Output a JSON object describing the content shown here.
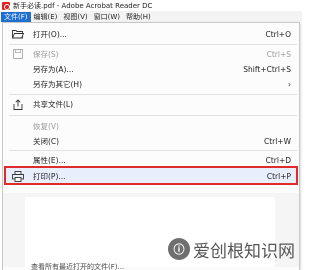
{
  "window": {
    "title": "新手必读.pdf - Adobe Acrobat Reader DC"
  },
  "menubar": {
    "items": [
      "文件(F)",
      "编辑(E)",
      "视图(V)",
      "窗口(W)",
      "帮助(H)"
    ]
  },
  "menu": {
    "open": {
      "label": "打开(O)...",
      "shortcut": "Ctrl+O"
    },
    "save": {
      "label": "保存(S)",
      "shortcut": "Ctrl+S"
    },
    "save_as": {
      "label": "另存为(A)...",
      "shortcut": "Shift+Ctrl+S"
    },
    "save_as_other": {
      "label": "另存为其它(H)",
      "shortcut": "›"
    },
    "share": {
      "label": "共享文件(L)"
    },
    "revert": {
      "label": "恢复(V)"
    },
    "close": {
      "label": "关闭(C)",
      "shortcut": "Ctrl+W"
    },
    "properties": {
      "label": "属性(E)...",
      "shortcut": "Ctrl+D"
    },
    "print": {
      "label": "打印(P)...",
      "shortcut": "Ctrl+P"
    }
  },
  "footer": {
    "partial_text": "查看所有最近打开的文件(F)..."
  },
  "watermark": {
    "text": "爱创根知识网"
  },
  "colors": {
    "accent": "#1e6fd0",
    "highlight_border": "#e02b2b"
  }
}
